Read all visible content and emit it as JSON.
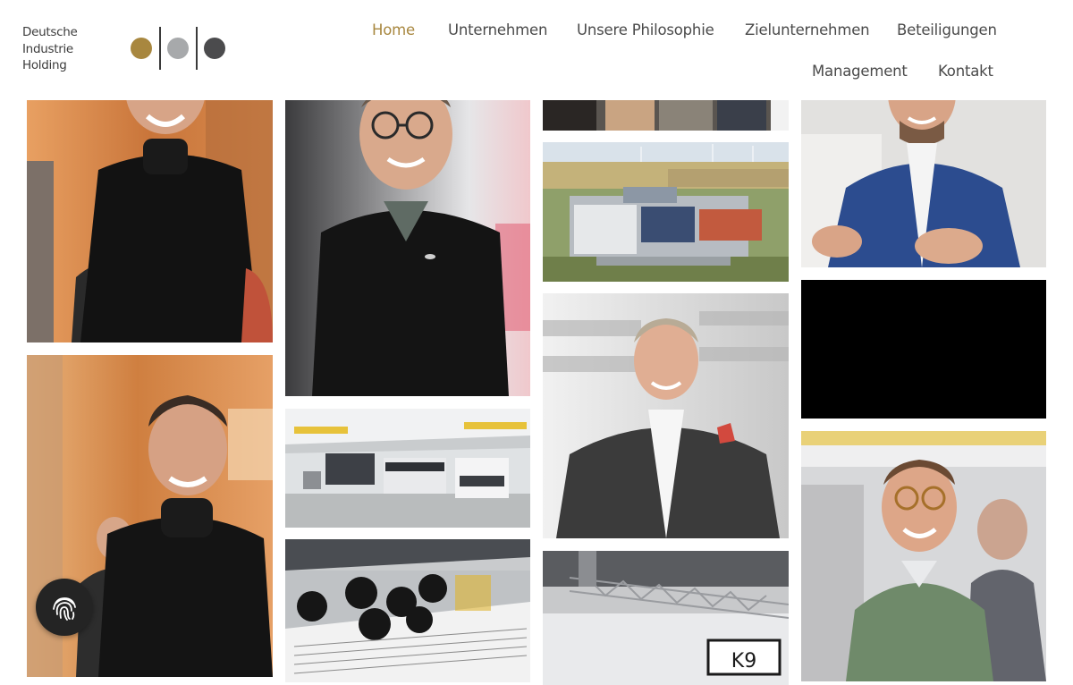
{
  "logo": {
    "lines": [
      "Deutsche",
      "Industrie",
      "Holding"
    ],
    "dot_colors": [
      "#a8873f",
      "#a7a9ab",
      "#4b4b4d"
    ]
  },
  "nav": {
    "items": [
      {
        "label": "Home",
        "active": true
      },
      {
        "label": "Unternehmen"
      },
      {
        "label": "Unsere Philosophie"
      },
      {
        "label": "Zielunternehmen"
      },
      {
        "label": "Beteiligungen"
      },
      {
        "label": "Management"
      },
      {
        "label": "Kontakt"
      }
    ]
  },
  "colors": {
    "accent": "#a8873f",
    "nav_text": "#4a4a4a"
  },
  "gallery": {
    "photos": [
      {
        "subject": "man-black-turtleneck-laughing"
      },
      {
        "subject": "man-glasses-black-polo"
      },
      {
        "subject": "group-cropped"
      },
      {
        "subject": "man-blue-blazer-gesturing"
      },
      {
        "subject": "man-black-turtleneck-laughing"
      },
      {
        "subject": "factory-hall-machines"
      },
      {
        "subject": "aerial-industrial-site"
      },
      {
        "subject": "black-video-placeholder"
      },
      {
        "subject": "printing-machine-rollers"
      },
      {
        "subject": "man-grey-blazer-smiling"
      },
      {
        "subject": "man-glasses-green-sweater-laughing"
      },
      {
        "subject": "trade-fair-booth-truss"
      }
    ]
  },
  "cookie_button": {
    "icon": "fingerprint-icon"
  }
}
